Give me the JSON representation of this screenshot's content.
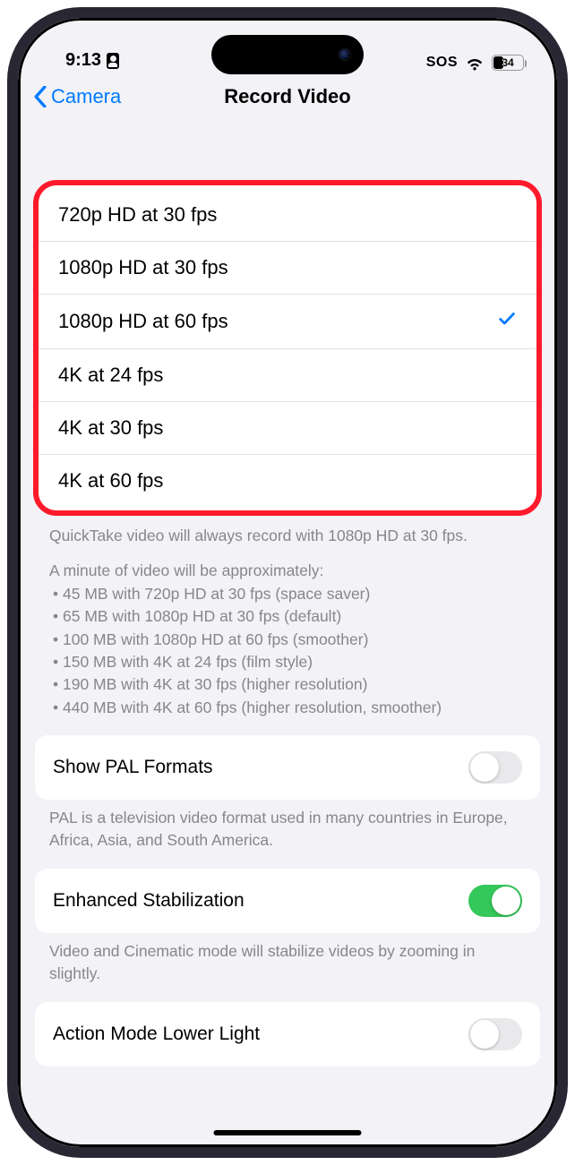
{
  "statusbar": {
    "time": "9:13",
    "sos": "SOS",
    "battery_pct": "34",
    "battery_fill_pct": 34
  },
  "nav": {
    "back_label": "Camera",
    "title": "Record Video"
  },
  "resolutions": {
    "options": [
      {
        "label": "720p HD at 30 fps",
        "selected": false
      },
      {
        "label": "1080p HD at 30 fps",
        "selected": false
      },
      {
        "label": "1080p HD at 60 fps",
        "selected": true
      },
      {
        "label": "4K at 24 fps",
        "selected": false
      },
      {
        "label": "4K at 30 fps",
        "selected": false
      },
      {
        "label": "4K at 60 fps",
        "selected": false
      }
    ],
    "quicktake_note": "QuickTake video will always record with 1080p HD at 30 fps.",
    "size_header": "A minute of video will be approximately:",
    "size_bullets": [
      "• 45 MB with 720p HD at 30 fps (space saver)",
      "• 65 MB with 1080p HD at 30 fps (default)",
      "• 100 MB with 1080p HD at 60 fps (smoother)",
      "• 150 MB with 4K at 24 fps (film style)",
      "• 190 MB with 4K at 30 fps (higher resolution)",
      "• 440 MB with 4K at 60 fps (higher resolution, smoother)"
    ]
  },
  "pal": {
    "label": "Show PAL Formats",
    "on": false,
    "footer": "PAL is a television video format used in many countries in Europe, Africa, Asia, and South America."
  },
  "stabilization": {
    "label": "Enhanced Stabilization",
    "on": true,
    "footer": "Video and Cinematic mode will stabilize videos by zooming in slightly."
  },
  "actionmode": {
    "label": "Action Mode Lower Light",
    "on": false
  }
}
